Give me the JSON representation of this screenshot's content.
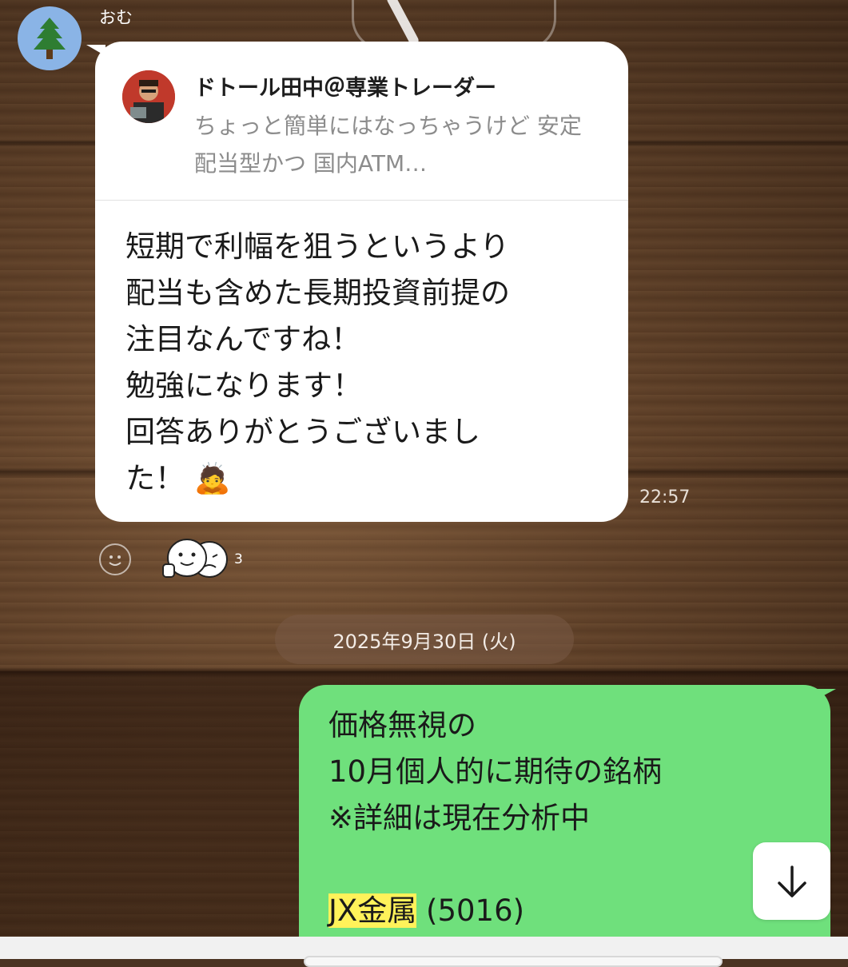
{
  "chat": {
    "sender_name": "おむ",
    "received": {
      "quote": {
        "author": "ドトール田中＠専業トレーダー",
        "text": "ちょっと簡単にはなっちゃうけど 安定配当型かつ 国内ATM…"
      },
      "text": "短期で利幅を狙うというより\n配当も含めた長期投資前提の\n注目なんですね！\n勉強になります！\n回答ありがとうございまし\nた！",
      "emoji": "🙇",
      "time": "22:57"
    },
    "reactions": {
      "count": "3",
      "add_icon": "smiley-add-icon",
      "stickers": [
        "thumbs-up-face-sticker",
        "crying-face-sticker"
      ]
    },
    "date_divider": "2025年9月30日 (火)",
    "sent": {
      "text": "価格無視の\n10月個人的に期待の銘柄\n※詳細は現在分析中",
      "stock_name": "JX金属",
      "stock_code": " (5016)"
    }
  },
  "controls": {
    "scroll_down_icon": "arrow-down-icon"
  },
  "colors": {
    "sent_bubble": "#6fe07c",
    "received_bubble": "#ffffff",
    "highlight": "#fff25a",
    "avatar_bg": "#8ab4e6"
  }
}
